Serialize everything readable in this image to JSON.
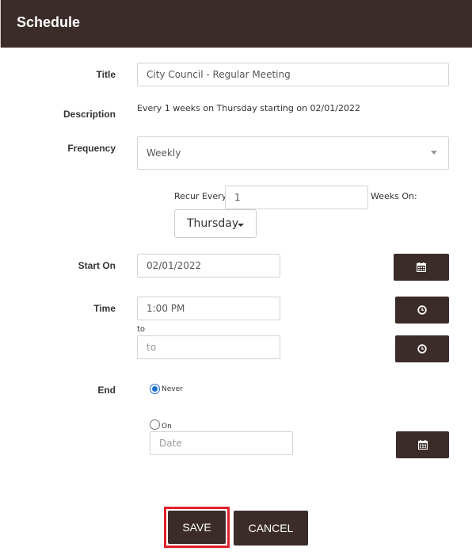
{
  "header": {
    "title": "Schedule"
  },
  "form": {
    "title_label": "Title",
    "title_value": "City Council - Regular Meeting",
    "description_label": "Description",
    "description_text": "Every 1 weeks on Thursday starting on 02/01/2022",
    "frequency_label": "Frequency",
    "frequency_value": "Weekly",
    "recur_every_label": "Recur Every",
    "recur_every_value": "1",
    "weeks_on_label": "Weeks On:",
    "day_value": "Thursday",
    "start_on_label": "Start On",
    "start_on_value": "02/01/2022",
    "time_label": "Time",
    "time_start_value": "1:00 PM",
    "to_label": "to",
    "time_end_placeholder": "to",
    "end_label": "End",
    "end_never_label": "Never",
    "end_on_label": "On",
    "end_date_placeholder": "Date"
  },
  "icons": {
    "calendar": "calendar-icon",
    "clock": "clock-icon"
  },
  "actions": {
    "save_label": "SAVE",
    "cancel_label": "CANCEL"
  },
  "colors": {
    "brand_dark": "#3b2c29",
    "highlight": "#e0202a",
    "radio_selected": "#1f6fd1"
  }
}
